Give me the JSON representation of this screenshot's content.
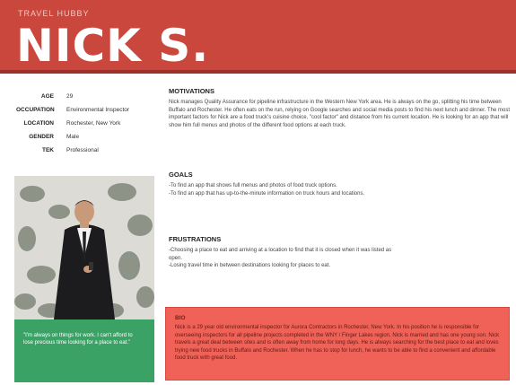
{
  "header": {
    "subtitle": "TRAVEL HUBBY",
    "title": "NICK S."
  },
  "profile": {
    "rows": [
      {
        "label": "AGE",
        "value": "29"
      },
      {
        "label": "OCCUPATION",
        "value": "Environmental Inspector"
      },
      {
        "label": "LOCATION",
        "value": "Rochester, New York"
      },
      {
        "label": "GENDER",
        "value": "Male"
      },
      {
        "label": "TEK",
        "value": "Professional"
      }
    ]
  },
  "photo_caption": "\"I'm always on things for work. I can't afford to lose precious time looking for a place to eat.\"",
  "motivations": {
    "heading": "MOTIVATIONS",
    "text": "Nick manages Quality Assurance for pipeline infrastructure in the Western New York area. He is always on the go, splitting his time between Buffalo and Rochester. He often eats on the run, relying on Google searches and social media posts to find his next lunch and dinner. The most important factors for Nick are a food truck's cuisine choice, \"cool factor\" and distance from his current location. He is looking for an app that will show him full menus and photos of the different food options at each truck."
  },
  "goals": {
    "heading": "GOALS",
    "items": [
      "-To find an app that shows full menus and photos of food truck options.",
      "-To find an app that has up-to-the-minute information on truck hours and locations."
    ]
  },
  "frustrations": {
    "heading": "FRUSTRATIONS",
    "items": [
      "-Choosing a place to eat and arriving at a location to find that it is closed when it was listed as open.",
      "-Losing travel time in between destinations looking for places to eat."
    ]
  },
  "bio": {
    "heading": "BIO",
    "text": "Nick is a 29 year old environmental inspector for Aurora Contractors in Rochester, New York. In his position he is responsible for overseeing inspectors for all pipeline projects completed in the WNY / Finger Lakes region. Nick is married and has one young son. Nick travels a great deal between sites and is often away from home for long days. He is always searching for the best place to eat and loves trying new food trucks in Buffalo and Rochester. When he has to stop for lunch, he wants to be able to find a convenient and affordable food truck with great food."
  },
  "colors": {
    "header": "#c9473d",
    "caption": "#3aa265",
    "bio": "#f06258"
  }
}
